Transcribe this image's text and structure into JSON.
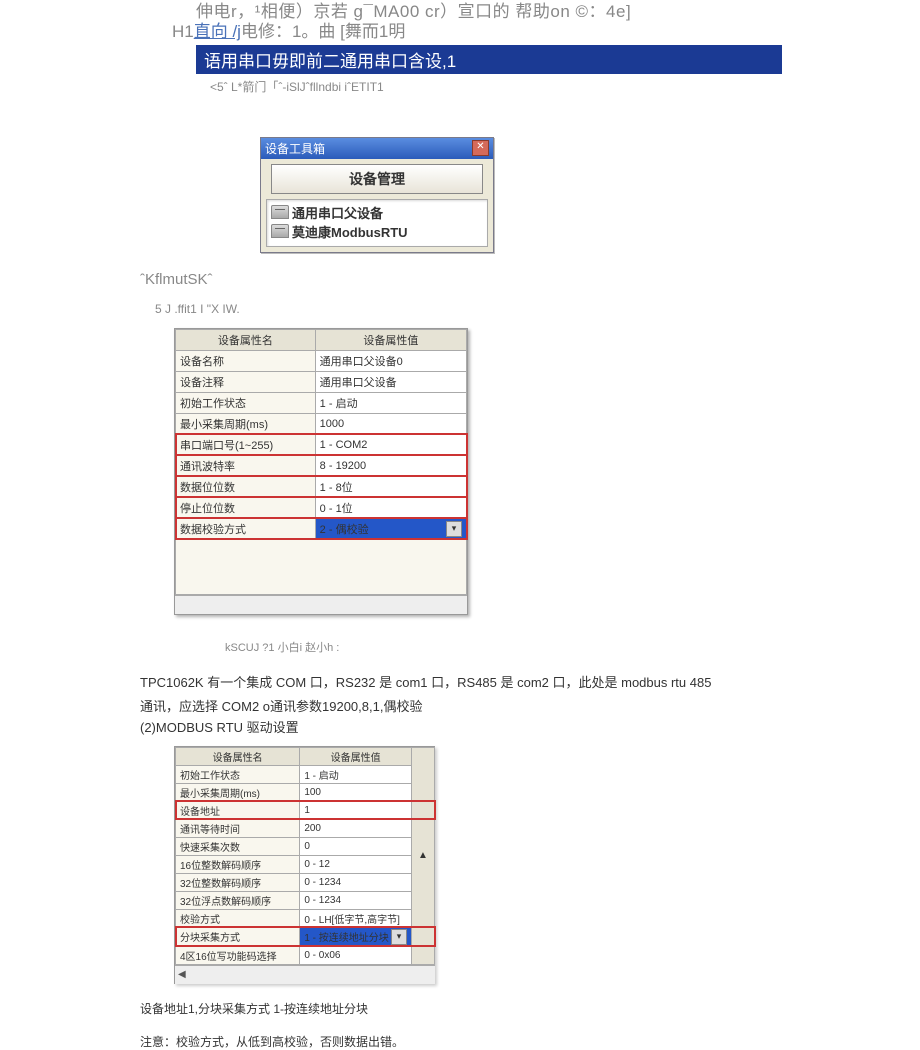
{
  "header": {
    "line1": "伸电r，¹相便）京若 g¯MA00 cr）宣口的 帮助on ©：4e]",
    "line2_pre": "H1",
    "line2_link": "直向 /j",
    "line2_mid": "电修：1。曲  [舞而1明",
    "banner": "语用串口毋即前二通用串口含设,1",
    "sub": "<5ˆ L*箭门「ˆ-iSlJˆfllndbi iˆETIT1"
  },
  "toolbox": {
    "title": "设备工具箱",
    "button": "设备管理",
    "items": [
      "通用串口父设备",
      "莫迪康ModbusRTU"
    ]
  },
  "frag1": "ˆKflmutSKˆ",
  "frag2": "5 J .ffit1 I \"X IW.",
  "propTable1": {
    "headers": [
      "设备属性名",
      "设备属性值"
    ],
    "rows": [
      {
        "k": "设备名称",
        "v": "通用串口父设备0"
      },
      {
        "k": "设备注释",
        "v": "通用串口父设备"
      },
      {
        "k": "初始工作状态",
        "v": "1 - 启动"
      },
      {
        "k": "最小采集周期(ms)",
        "v": "1000"
      },
      {
        "k": "串口端口号(1~255)",
        "v": "1 - COM2"
      },
      {
        "k": "通讯波特率",
        "v": "8 - 19200"
      },
      {
        "k": "数据位位数",
        "v": "1 - 8位"
      },
      {
        "k": "停止位位数",
        "v": "0 - 1位"
      },
      {
        "k": "数据校验方式",
        "v": "2 - 偶校验"
      }
    ]
  },
  "caption1": "kSCUJ          ?1 小白i 赵小h :",
  "body1": "TPC1062K 有一个集成 COM 口，RS232 是 com1 口，RS485 是 com2 口，此处是 modbus rtu 485",
  "body2": "通讯，应选择 COM2 o通讯参数19200,8,1,偶校验",
  "section2": "(2)MODBUS RTU 驱动设置",
  "propTable2": {
    "headers": [
      "设备属性名",
      "设备属性值"
    ],
    "rows": [
      {
        "k": "初始工作状态",
        "v": "1 - 启动"
      },
      {
        "k": "最小采集周期(ms)",
        "v": "100"
      },
      {
        "k": "设备地址",
        "v": "1"
      },
      {
        "k": "通讯等待时间",
        "v": "200"
      },
      {
        "k": "快速采集次数",
        "v": "0"
      },
      {
        "k": "16位整数解码顺序",
        "v": "0 - 12"
      },
      {
        "k": "32位整数解码顺序",
        "v": "0 - 1234"
      },
      {
        "k": "32位浮点数解码顺序",
        "v": "0 - 1234"
      },
      {
        "k": "校验方式",
        "v": "0 - LH[低字节,高字节]"
      },
      {
        "k": "分块采集方式",
        "v": "1 - 按连续地址分块"
      },
      {
        "k": "4区16位写功能码选择",
        "v": "0 - 0x06"
      }
    ]
  },
  "note1": "设备地址1,分块采集方式 1-按连续地址分块",
  "note2": "注意：校验方式，从低到高校验，否则数据出错。"
}
